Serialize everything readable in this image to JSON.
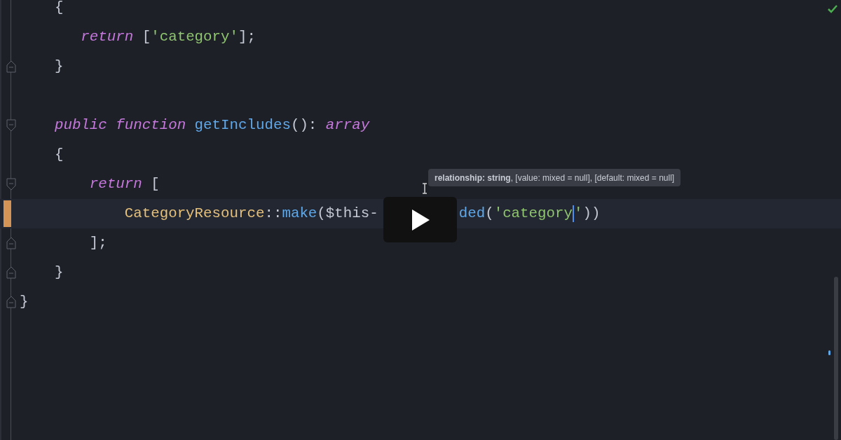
{
  "lines": [
    {
      "fold_start": false,
      "fold_end": false,
      "current": false,
      "tokens": [
        {
          "kind": "plain",
          "text": "    {"
        }
      ]
    },
    {
      "fold_start": false,
      "fold_end": false,
      "current": false,
      "tokens": [
        {
          "kind": "keyword",
          "text": "       return"
        },
        {
          "kind": "plain",
          "text": " ["
        },
        {
          "kind": "string",
          "text": "'category'"
        },
        {
          "kind": "plain",
          "text": "];"
        }
      ]
    },
    {
      "fold_start": false,
      "fold_end": true,
      "current": false,
      "tokens": [
        {
          "kind": "plain",
          "text": "    }"
        }
      ]
    },
    {
      "fold_start": false,
      "fold_end": false,
      "current": false
    },
    {
      "fold_start": true,
      "fold_end": false,
      "current": false,
      "tokens": [
        {
          "kind": "keyword",
          "text": "    public function "
        },
        {
          "kind": "function",
          "text": "getIncludes"
        },
        {
          "kind": "plain",
          "text": "(): "
        },
        {
          "kind": "keyword",
          "text": "array"
        }
      ]
    },
    {
      "fold_start": false,
      "fold_end": false,
      "current": false,
      "tokens": [
        {
          "kind": "plain",
          "text": "    {"
        }
      ]
    },
    {
      "fold_start": true,
      "fold_end": false,
      "current": false,
      "tokens": [
        {
          "kind": "keyword",
          "text": "        return"
        },
        {
          "kind": "plain",
          "text": " ["
        }
      ]
    },
    {
      "fold_start": false,
      "fold_end": false,
      "current": true,
      "tokens": [
        {
          "kind": "class",
          "text": "            CategoryResource"
        },
        {
          "kind": "plain",
          "text": "::"
        },
        {
          "kind": "function",
          "text": "make"
        },
        {
          "kind": "plain",
          "text": "($this-"
        },
        {
          "kind": "gap"
        },
        {
          "kind": "function",
          "text": "ded"
        },
        {
          "kind": "plain",
          "text": "("
        },
        {
          "kind": "string",
          "text": "'category"
        },
        {
          "kind": "caret"
        },
        {
          "kind": "string",
          "text": "'"
        },
        {
          "kind": "plain",
          "text": "))"
        }
      ]
    },
    {
      "fold_start": false,
      "fold_end": true,
      "current": false,
      "tokens": [
        {
          "kind": "plain",
          "text": "        ];"
        }
      ]
    },
    {
      "fold_start": false,
      "fold_end": true,
      "current": false,
      "tokens": [
        {
          "kind": "plain",
          "text": "    }"
        }
      ]
    },
    {
      "fold_start": false,
      "fold_end": true,
      "current": false,
      "tokens": [
        {
          "kind": "plain",
          "text": "}"
        }
      ]
    }
  ],
  "tooltip": {
    "text": "**relationship: string**, [value: mixed = null], [default: mixed = null]"
  },
  "inspection": {
    "ok": true
  },
  "video": {
    "paused": true
  }
}
